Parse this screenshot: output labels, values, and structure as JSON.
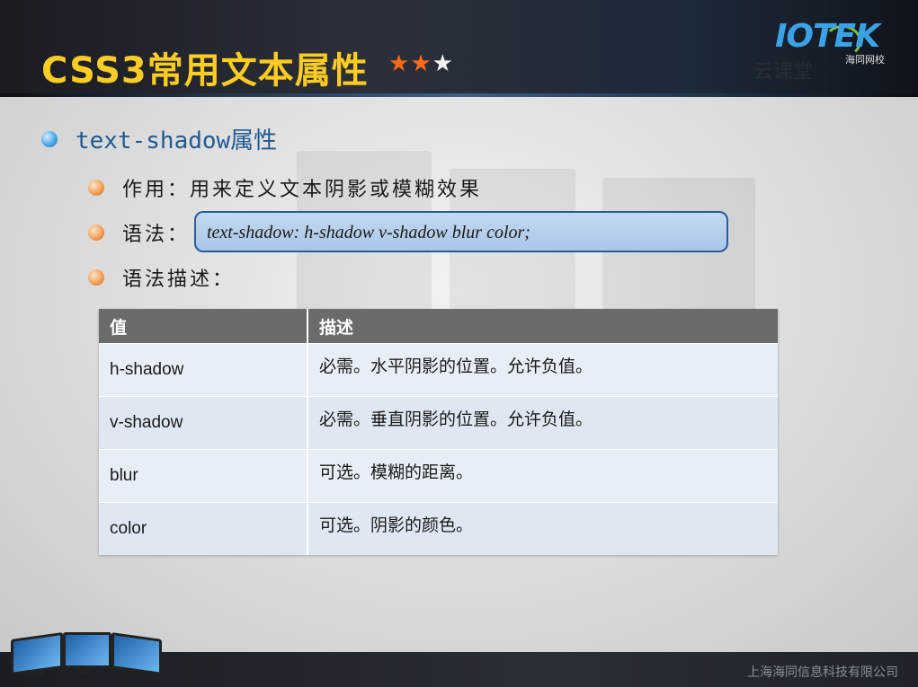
{
  "header": {
    "title": "CSS3常用文本属性",
    "stars": [
      {
        "char": "★",
        "color": "#ff6a1a"
      },
      {
        "char": "★",
        "color": "#ff6a1a"
      },
      {
        "char": "★",
        "color": "#f2f2f2"
      }
    ],
    "logo_text": "IOTEK",
    "logo_subtitle": "海同网校",
    "watermark": "云课堂"
  },
  "content": {
    "heading": "text-shadow属性",
    "items": [
      {
        "label": "作用：用来定义文本阴影或模糊效果"
      },
      {
        "label": "语法："
      },
      {
        "label": "语法描述："
      }
    ],
    "syntax": "text-shadow: h-shadow v-shadow blur color;",
    "table": {
      "headers": [
        "值",
        "描述"
      ],
      "rows": [
        [
          "h-shadow",
          "必需。水平阴影的位置。允许负值。"
        ],
        [
          "v-shadow",
          "必需。垂直阴影的位置。允许负值。"
        ],
        [
          "blur",
          "可选。模糊的距离。"
        ],
        [
          "color",
          "可选。阴影的颜色。"
        ]
      ]
    }
  },
  "footer": {
    "company": "上海海同信息科技有限公司"
  },
  "colors": {
    "title": "#ffcc22",
    "heading": "#1f5a94",
    "table_header": "#6b6b6b",
    "syntax_border": "#2a5b9a"
  }
}
